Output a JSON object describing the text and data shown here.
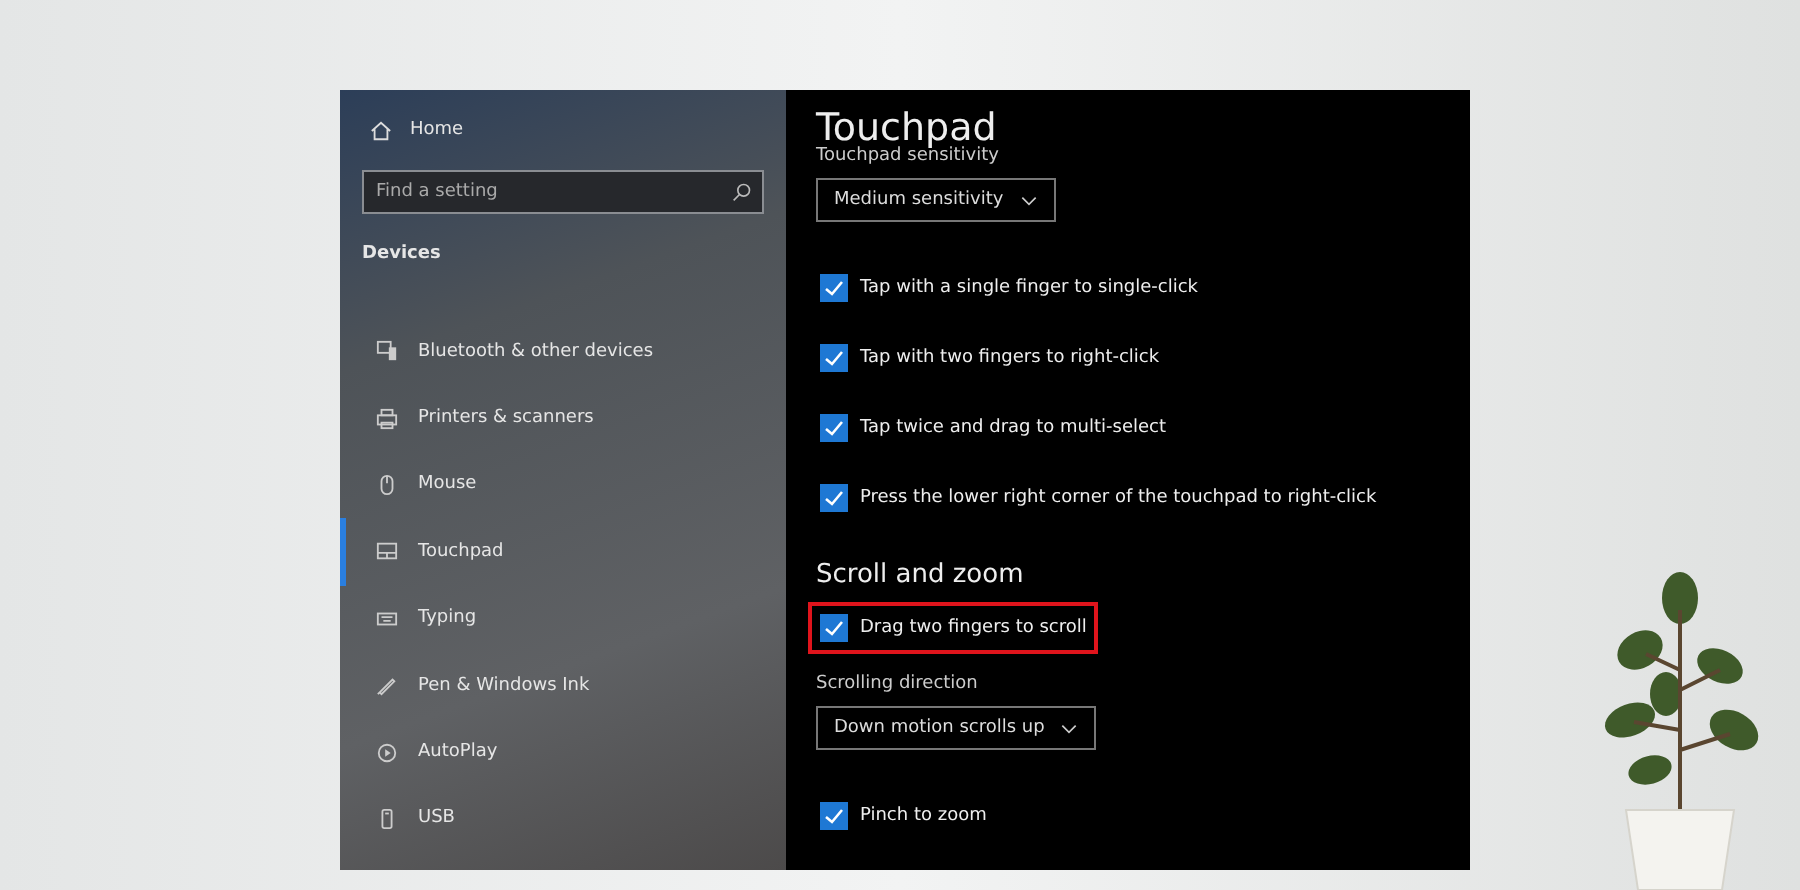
{
  "sidebar": {
    "home": "Home",
    "search": {
      "placeholder": "Find a setting"
    },
    "heading": "Devices",
    "items": [
      {
        "label": "Bluetooth & other devices",
        "selected": false
      },
      {
        "label": "Printers & scanners",
        "selected": false
      },
      {
        "label": "Mouse",
        "selected": false
      },
      {
        "label": "Touchpad",
        "selected": true
      },
      {
        "label": "Typing",
        "selected": false
      },
      {
        "label": "Pen & Windows Ink",
        "selected": false
      },
      {
        "label": "AutoPlay",
        "selected": false
      },
      {
        "label": "USB",
        "selected": false
      }
    ]
  },
  "content": {
    "title": "Touchpad",
    "sensitivity": {
      "label": "Touchpad sensitivity",
      "value": "Medium sensitivity"
    },
    "tap_options": [
      {
        "label": "Tap with a single finger to single-click",
        "checked": true,
        "highlighted": false
      },
      {
        "label": "Tap with two fingers to right-click",
        "checked": true,
        "highlighted": false
      },
      {
        "label": "Tap twice and drag to multi-select",
        "checked": true,
        "highlighted": false
      },
      {
        "label": "Press the lower right corner of the touchpad to right-click",
        "checked": true,
        "highlighted": false
      }
    ],
    "scroll_heading": "Scroll and zoom",
    "scroll_options": [
      {
        "label": "Drag two fingers to scroll",
        "checked": true,
        "highlighted": true
      }
    ],
    "direction": {
      "label": "Scrolling direction",
      "value": "Down motion scrolls up"
    },
    "zoom_options": [
      {
        "label": "Pinch to zoom",
        "checked": true,
        "highlighted": false
      }
    ]
  }
}
